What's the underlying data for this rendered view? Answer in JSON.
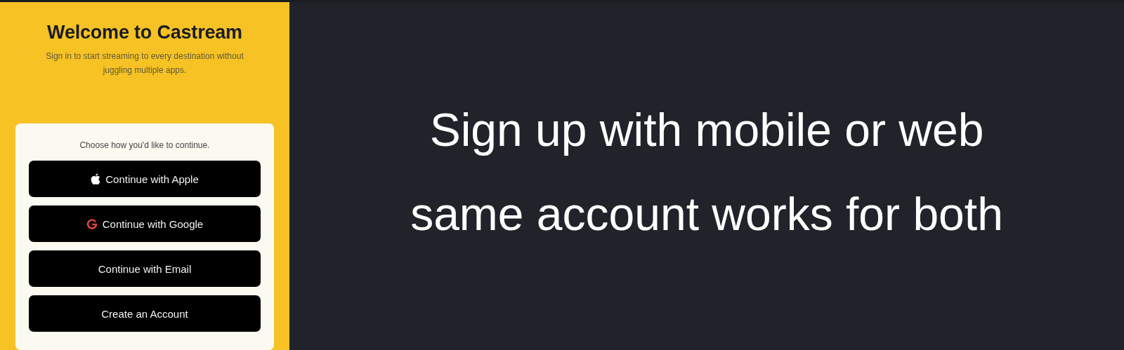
{
  "welcome": {
    "title": "Welcome to Castream",
    "subtitle": "Sign in to start streaming to every destination without juggling multiple apps."
  },
  "card": {
    "prompt": "Choose how you'd like to continue.",
    "buttons": [
      {
        "label": "Continue with Apple",
        "kind": "apple"
      },
      {
        "label": "Continue with Google",
        "kind": "google"
      },
      {
        "label": "Continue with Email",
        "kind": "plain"
      },
      {
        "label": "Create an Account",
        "kind": "plain"
      }
    ]
  },
  "caption": {
    "lines": [
      "Sign up with mobile or web",
      "same account works for both"
    ]
  }
}
